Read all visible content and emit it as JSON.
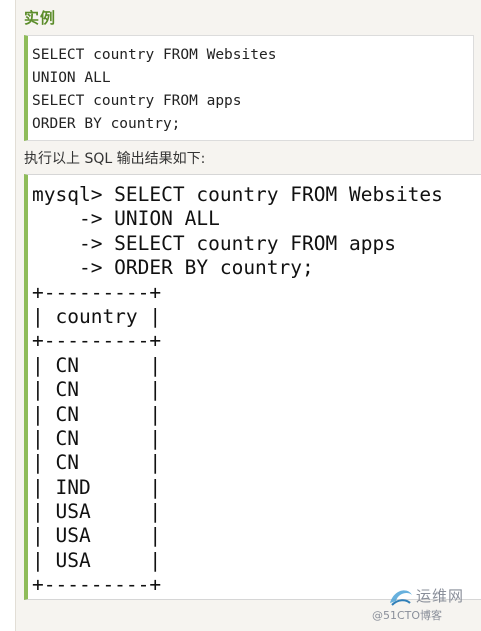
{
  "section_heading": "实例",
  "example_code": [
    "SELECT country FROM Websites",
    "UNION ALL",
    "SELECT country FROM apps",
    "ORDER BY country;"
  ],
  "output_caption": "执行以上 SQL 输出结果如下:",
  "output_lines": [
    "mysql> SELECT country FROM Websites",
    "    -> UNION ALL",
    "    -> SELECT country FROM apps",
    "    -> ORDER BY country;",
    "+---------+",
    "| country |",
    "+---------+",
    "| CN      |",
    "| CN      |",
    "| CN      |",
    "| CN      |",
    "| CN      |",
    "| IND     |",
    "| USA     |",
    "| USA     |",
    "| USA     |",
    "+---------+"
  ],
  "watermark": {
    "line1": "运维网",
    "line2": "@51CTO博客"
  },
  "colors": {
    "heading_green": "#5b8c2a",
    "box_accent": "#8fbc5a",
    "page_bg": "#f6f4f0"
  }
}
